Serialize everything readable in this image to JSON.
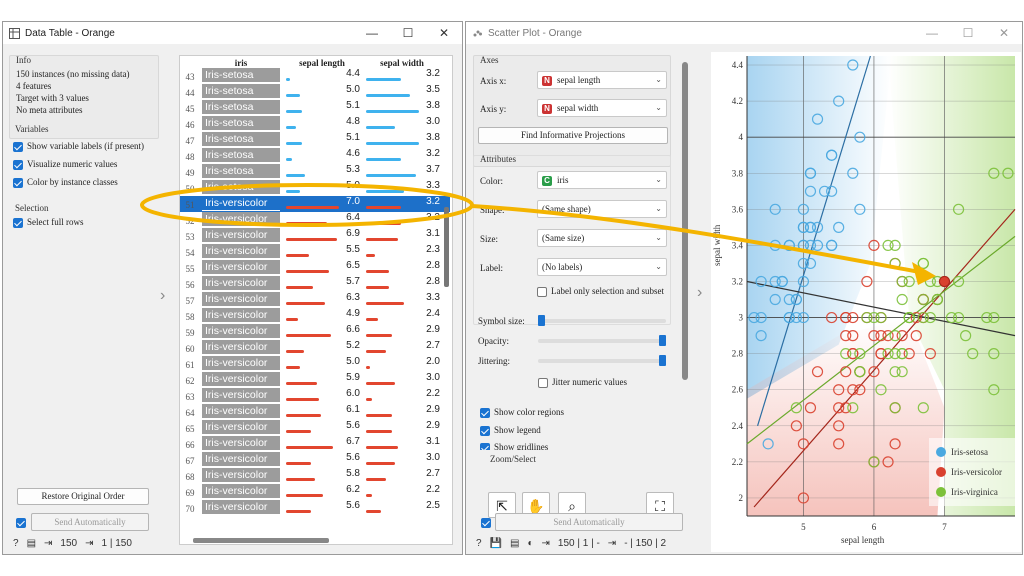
{
  "w1": {
    "title": "Data Table - Orange",
    "info_title": "Info",
    "info_lines": [
      "150 instances (no missing data)",
      "4 features",
      "Target with 3 values",
      "No meta attributes"
    ],
    "vars_title": "Variables",
    "vars": [
      "Show variable labels (if present)",
      "Visualize numeric values",
      "Color by instance classes"
    ],
    "sel_title": "Selection",
    "sel_item": "Select full rows",
    "restore": "Restore Original Order",
    "send": "Send Automatically",
    "status": {
      "count": "150",
      "ratio": "1 | 150"
    },
    "cols": [
      "iris",
      "sepal length",
      "sepal width"
    ],
    "rows": [
      {
        "n": "43",
        "s": "Iris-setosa",
        "a": "4.4",
        "b": "3.2"
      },
      {
        "n": "44",
        "s": "Iris-setosa",
        "a": "5.0",
        "b": "3.5"
      },
      {
        "n": "45",
        "s": "Iris-setosa",
        "a": "5.1",
        "b": "3.8"
      },
      {
        "n": "46",
        "s": "Iris-setosa",
        "a": "4.8",
        "b": "3.0"
      },
      {
        "n": "47",
        "s": "Iris-setosa",
        "a": "5.1",
        "b": "3.8"
      },
      {
        "n": "48",
        "s": "Iris-setosa",
        "a": "4.6",
        "b": "3.2"
      },
      {
        "n": "49",
        "s": "Iris-setosa",
        "a": "5.3",
        "b": "3.7"
      },
      {
        "n": "50",
        "s": "Iris-setosa",
        "a": "5.0",
        "b": "3.3"
      },
      {
        "n": "51",
        "s": "Iris-versicolor",
        "a": "7.0",
        "b": "3.2"
      },
      {
        "n": "52",
        "s": "Iris-versicolor",
        "a": "6.4",
        "b": "3.2"
      },
      {
        "n": "53",
        "s": "Iris-versicolor",
        "a": "6.9",
        "b": "3.1"
      },
      {
        "n": "54",
        "s": "Iris-versicolor",
        "a": "5.5",
        "b": "2.3"
      },
      {
        "n": "55",
        "s": "Iris-versicolor",
        "a": "6.5",
        "b": "2.8"
      },
      {
        "n": "56",
        "s": "Iris-versicolor",
        "a": "5.7",
        "b": "2.8"
      },
      {
        "n": "57",
        "s": "Iris-versicolor",
        "a": "6.3",
        "b": "3.3"
      },
      {
        "n": "58",
        "s": "Iris-versicolor",
        "a": "4.9",
        "b": "2.4"
      },
      {
        "n": "59",
        "s": "Iris-versicolor",
        "a": "6.6",
        "b": "2.9"
      },
      {
        "n": "60",
        "s": "Iris-versicolor",
        "a": "5.2",
        "b": "2.7"
      },
      {
        "n": "61",
        "s": "Iris-versicolor",
        "a": "5.0",
        "b": "2.0"
      },
      {
        "n": "62",
        "s": "Iris-versicolor",
        "a": "5.9",
        "b": "3.0"
      },
      {
        "n": "63",
        "s": "Iris-versicolor",
        "a": "6.0",
        "b": "2.2"
      },
      {
        "n": "64",
        "s": "Iris-versicolor",
        "a": "6.1",
        "b": "2.9"
      },
      {
        "n": "65",
        "s": "Iris-versicolor",
        "a": "5.6",
        "b": "2.9"
      },
      {
        "n": "66",
        "s": "Iris-versicolor",
        "a": "6.7",
        "b": "3.1"
      },
      {
        "n": "67",
        "s": "Iris-versicolor",
        "a": "5.6",
        "b": "3.0"
      },
      {
        "n": "68",
        "s": "Iris-versicolor",
        "a": "5.8",
        "b": "2.7"
      },
      {
        "n": "69",
        "s": "Iris-versicolor",
        "a": "6.2",
        "b": "2.2"
      },
      {
        "n": "70",
        "s": "Iris-versicolor",
        "a": "5.6",
        "b": "2.5"
      }
    ],
    "selected_row": "51"
  },
  "w2": {
    "title": "Scatter Plot - Orange",
    "axes_title": "Axes",
    "axis_x_label": "Axis x:",
    "axis_x": "sepal length",
    "axis_y_label": "Axis y:",
    "axis_y": "sepal width",
    "find": "Find Informative Projections",
    "attr_title": "Attributes",
    "color_label": "Color:",
    "color": "iris",
    "shape_label": "Shape:",
    "shape": "(Same shape)",
    "size_label": "Size:",
    "size": "(Same size)",
    "label_label": "Label:",
    "label": "(No labels)",
    "label_only": "Label only selection and subset",
    "symbol_size": "Symbol size:",
    "opacity": "Opacity:",
    "jittering": "Jittering:",
    "jitter_numeric": "Jitter numeric values",
    "show_color_regions": "Show color regions",
    "show_legend": "Show legend",
    "show_gridlines": "Show gridlines",
    "zoom_title": "Zoom/Select",
    "send": "Send Automatically",
    "status": {
      "ratio1": "150 | 1 | -",
      "ratio2": "- | 150 | 2"
    },
    "symbol_size_level": 0.05,
    "opacity_level": 1.0,
    "jitter_level": 1.0
  },
  "chart_data": {
    "type": "scatter",
    "xlabel": "sepal length",
    "ylabel": "sepal width",
    "xlim": [
      4.2,
      8.0
    ],
    "ylim": [
      1.9,
      4.45
    ],
    "xticks": [
      "5",
      "6",
      "7"
    ],
    "yticks": [
      "2",
      "2.2",
      "2.4",
      "2.6",
      "2.8",
      "3",
      "3.2",
      "3.4",
      "3.6",
      "3.8",
      "4",
      "4.2",
      "4.4"
    ],
    "legend_position": "bottom-right",
    "colors": {
      "Iris-setosa": "#4aa9e0",
      "Iris-versicolor": "#d9412f",
      "Iris-virginica": "#7cc13a"
    },
    "series": [
      {
        "name": "Iris-setosa",
        "points": [
          [
            5.1,
            3.5
          ],
          [
            4.9,
            3.0
          ],
          [
            4.7,
            3.2
          ],
          [
            4.6,
            3.1
          ],
          [
            5.0,
            3.6
          ],
          [
            5.4,
            3.9
          ],
          [
            4.6,
            3.4
          ],
          [
            5.0,
            3.4
          ],
          [
            4.4,
            2.9
          ],
          [
            4.9,
            3.1
          ],
          [
            5.4,
            3.7
          ],
          [
            4.8,
            3.4
          ],
          [
            4.8,
            3.0
          ],
          [
            4.3,
            3.0
          ],
          [
            5.8,
            4.0
          ],
          [
            5.7,
            4.4
          ],
          [
            5.4,
            3.9
          ],
          [
            5.1,
            3.5
          ],
          [
            5.7,
            3.8
          ],
          [
            5.1,
            3.8
          ],
          [
            5.4,
            3.4
          ],
          [
            5.1,
            3.7
          ],
          [
            4.6,
            3.6
          ],
          [
            5.1,
            3.3
          ],
          [
            4.8,
            3.4
          ],
          [
            5.0,
            3.0
          ],
          [
            5.0,
            3.4
          ],
          [
            5.2,
            3.5
          ],
          [
            5.2,
            3.4
          ],
          [
            4.7,
            3.2
          ],
          [
            4.8,
            3.1
          ],
          [
            5.4,
            3.4
          ],
          [
            5.2,
            4.1
          ],
          [
            5.5,
            4.2
          ],
          [
            4.9,
            3.1
          ],
          [
            5.0,
            3.2
          ],
          [
            5.5,
            3.5
          ],
          [
            4.4,
            3.0
          ],
          [
            5.1,
            3.4
          ],
          [
            5.0,
            3.5
          ],
          [
            4.5,
            2.3
          ],
          [
            4.4,
            3.2
          ],
          [
            5.0,
            3.5
          ],
          [
            5.1,
            3.8
          ],
          [
            4.8,
            3.0
          ],
          [
            4.6,
            3.2
          ],
          [
            5.3,
            3.7
          ],
          [
            5.0,
            3.3
          ],
          [
            5.8,
            3.6
          ]
        ]
      },
      {
        "name": "Iris-versicolor",
        "points": [
          [
            7.0,
            3.2
          ],
          [
            6.4,
            3.2
          ],
          [
            6.9,
            3.1
          ],
          [
            5.5,
            2.3
          ],
          [
            6.5,
            2.8
          ],
          [
            5.7,
            2.8
          ],
          [
            6.3,
            3.3
          ],
          [
            4.9,
            2.4
          ],
          [
            6.6,
            2.9
          ],
          [
            5.2,
            2.7
          ],
          [
            5.0,
            2.0
          ],
          [
            5.9,
            3.0
          ],
          [
            6.0,
            2.2
          ],
          [
            6.1,
            2.9
          ],
          [
            5.6,
            2.9
          ],
          [
            6.7,
            3.1
          ],
          [
            5.6,
            3.0
          ],
          [
            5.8,
            2.7
          ],
          [
            6.2,
            2.2
          ],
          [
            5.6,
            2.5
          ],
          [
            5.9,
            3.2
          ],
          [
            6.1,
            2.8
          ],
          [
            6.3,
            2.5
          ],
          [
            6.1,
            2.8
          ],
          [
            6.4,
            2.9
          ],
          [
            6.6,
            3.0
          ],
          [
            6.8,
            2.8
          ],
          [
            6.7,
            3.0
          ],
          [
            6.0,
            2.9
          ],
          [
            5.7,
            2.6
          ],
          [
            5.5,
            2.4
          ],
          [
            5.8,
            2.7
          ],
          [
            6.0,
            2.7
          ],
          [
            5.4,
            3.0
          ],
          [
            6.0,
            3.4
          ],
          [
            6.7,
            3.1
          ],
          [
            6.3,
            2.3
          ],
          [
            5.6,
            3.0
          ],
          [
            5.5,
            2.5
          ],
          [
            5.5,
            2.6
          ],
          [
            6.1,
            3.0
          ],
          [
            5.8,
            2.6
          ],
          [
            5.0,
            2.3
          ],
          [
            5.6,
            2.7
          ],
          [
            5.7,
            3.0
          ],
          [
            5.7,
            2.9
          ],
          [
            6.2,
            2.9
          ],
          [
            5.1,
            2.5
          ],
          [
            5.7,
            2.8
          ]
        ]
      },
      {
        "name": "Iris-virginica",
        "points": [
          [
            6.3,
            3.3
          ],
          [
            5.8,
            2.7
          ],
          [
            7.1,
            3.0
          ],
          [
            6.3,
            2.9
          ],
          [
            6.5,
            3.0
          ],
          [
            7.6,
            3.0
          ],
          [
            4.9,
            2.5
          ],
          [
            7.3,
            2.9
          ],
          [
            6.7,
            2.5
          ],
          [
            7.2,
            3.6
          ],
          [
            6.5,
            3.2
          ],
          [
            6.4,
            2.7
          ],
          [
            6.8,
            3.0
          ],
          [
            5.7,
            2.5
          ],
          [
            5.8,
            2.8
          ],
          [
            6.4,
            3.2
          ],
          [
            6.5,
            3.0
          ],
          [
            7.7,
            3.8
          ],
          [
            7.7,
            2.6
          ],
          [
            6.0,
            2.2
          ],
          [
            6.9,
            3.2
          ],
          [
            5.6,
            2.8
          ],
          [
            7.7,
            2.8
          ],
          [
            6.3,
            2.7
          ],
          [
            6.7,
            3.3
          ],
          [
            7.2,
            3.2
          ],
          [
            6.2,
            2.8
          ],
          [
            6.1,
            3.0
          ],
          [
            6.4,
            2.8
          ],
          [
            7.2,
            3.0
          ],
          [
            7.4,
            2.8
          ],
          [
            7.9,
            3.8
          ],
          [
            6.4,
            2.8
          ],
          [
            6.3,
            2.8
          ],
          [
            6.1,
            2.6
          ],
          [
            7.7,
            3.0
          ],
          [
            6.3,
            3.4
          ],
          [
            6.4,
            3.1
          ],
          [
            6.0,
            3.0
          ],
          [
            6.9,
            3.1
          ],
          [
            6.7,
            3.1
          ],
          [
            6.9,
            3.1
          ],
          [
            5.8,
            2.7
          ],
          [
            6.8,
            3.2
          ],
          [
            6.7,
            3.3
          ],
          [
            6.7,
            3.0
          ],
          [
            6.3,
            2.5
          ],
          [
            6.5,
            3.0
          ],
          [
            6.2,
            3.4
          ],
          [
            5.9,
            3.0
          ]
        ]
      }
    ],
    "selected_point": [
      7.0,
      3.2
    ]
  }
}
